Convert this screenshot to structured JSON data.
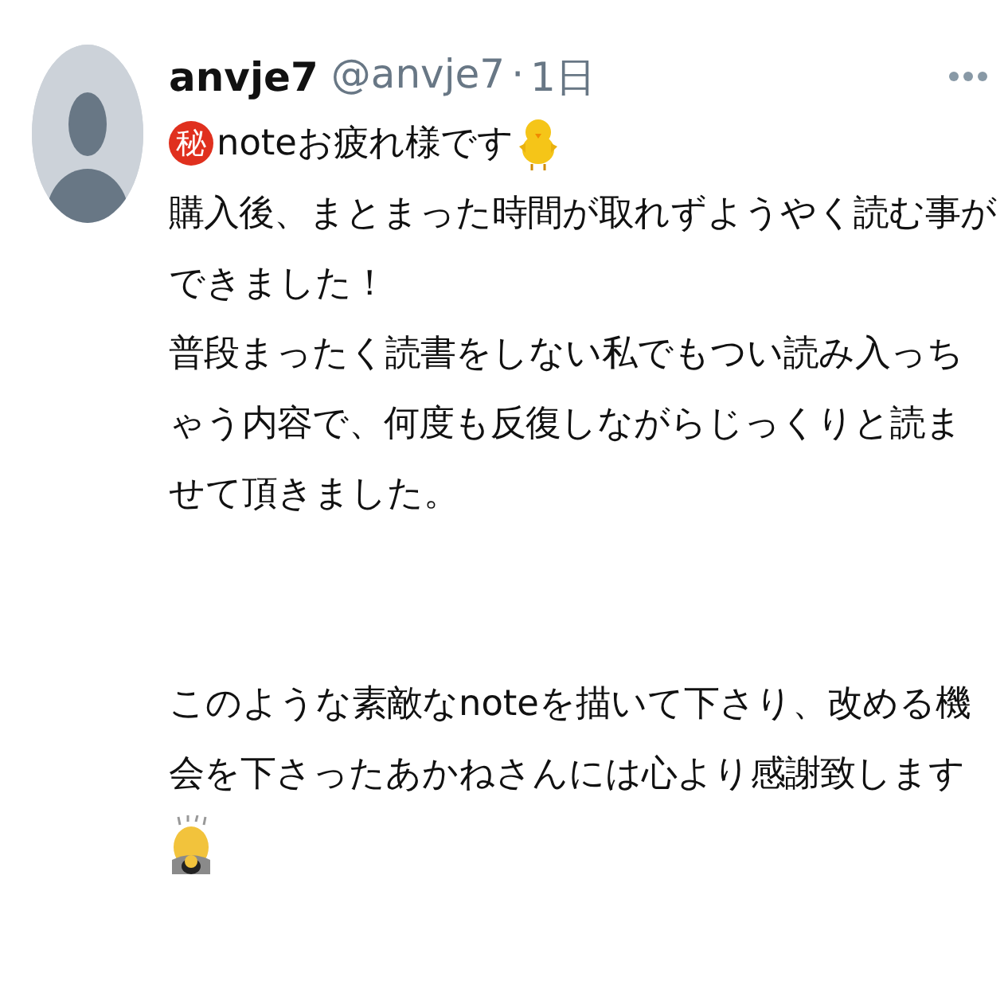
{
  "tweet": {
    "author": {
      "name": "anvje7",
      "handle": "@anvje7",
      "separator": "·",
      "time": "1日"
    },
    "first_line": {
      "badge": "秘",
      "text": "noteお疲れ様です"
    },
    "paragraphs": [
      "購入後、まとまった時間が取れずようやく読む事ができました！",
      "普段まったく読書をしない私でもつい読み入っちゃう内容で、何度も反復しながらじっくりと読ませて頂きました。",
      "このような素敵なnoteを描いて下さり、改める機会を下さったあかねさんには心より感謝致します"
    ]
  }
}
